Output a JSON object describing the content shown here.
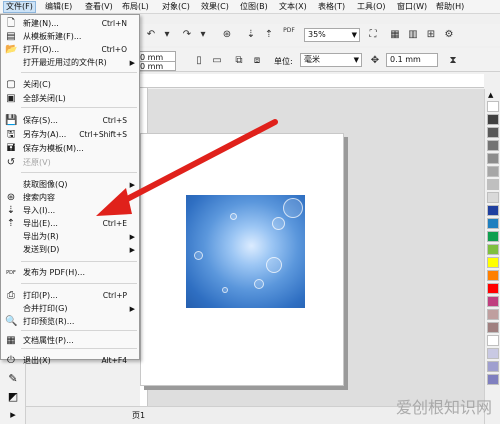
{
  "menubar": {
    "items": [
      {
        "label": "文件(F)",
        "active": true
      },
      {
        "label": "编辑(E)"
      },
      {
        "label": "查看(V)"
      },
      {
        "label": "布局(L)"
      },
      {
        "label": "对象(C)"
      },
      {
        "label": "效果(C)"
      },
      {
        "label": "位图(B)"
      },
      {
        "label": "文本(X)"
      },
      {
        "label": "表格(T)"
      },
      {
        "label": "工具(O)"
      },
      {
        "label": "窗口(W)"
      },
      {
        "label": "帮助(H)"
      }
    ]
  },
  "toolbar": {
    "zoom_value": "35%",
    "width_value": "0 mm",
    "height_value": "0 mm",
    "unit_label": "单位:",
    "unit_value": "毫米",
    "nudge_value": "0.1 mm",
    "pdf_label": "PDF"
  },
  "file_menu": {
    "items": [
      {
        "icon": "new-file-icon",
        "glyph": "🗋",
        "label": "新建(N)...",
        "shortcut": "Ctrl+N"
      },
      {
        "icon": "template-icon",
        "glyph": "▤",
        "label": "从模板新建(F)..."
      },
      {
        "icon": "open-folder-icon",
        "glyph": "📂",
        "label": "打开(O)...",
        "shortcut": "Ctrl+O"
      },
      {
        "icon": "",
        "glyph": "",
        "label": "打开最近用过的文件(R)",
        "submenu": true
      },
      {
        "icon": "close-icon",
        "glyph": "▢",
        "label": "关闭(C)"
      },
      {
        "icon": "close-all-icon",
        "glyph": "▣",
        "label": "全部关闭(L)"
      },
      {
        "icon": "save-icon",
        "glyph": "💾",
        "label": "保存(S)...",
        "shortcut": "Ctrl+S"
      },
      {
        "icon": "save-as-icon",
        "glyph": "🖫",
        "label": "另存为(A)...",
        "shortcut": "Ctrl+Shift+S"
      },
      {
        "icon": "save-template-icon",
        "glyph": "🖬",
        "label": "保存为模板(M)..."
      },
      {
        "icon": "revert-icon",
        "glyph": "↺",
        "label": "还原(V)",
        "disabled": true
      },
      {
        "icon": "",
        "glyph": "",
        "label": "获取图像(Q)",
        "submenu": true
      },
      {
        "icon": "search-content-icon",
        "glyph": "⊛",
        "label": "搜索内容"
      },
      {
        "icon": "import-icon",
        "glyph": "⇣",
        "label": "导入(I)..."
      },
      {
        "icon": "export-icon",
        "glyph": "⇡",
        "label": "导出(E)...",
        "shortcut": "Ctrl+E"
      },
      {
        "icon": "",
        "glyph": "",
        "label": "导出为(R)",
        "submenu": true
      },
      {
        "icon": "",
        "glyph": "",
        "label": "发送到(D)",
        "submenu": true
      },
      {
        "icon": "pdf-icon",
        "glyph": "PDF",
        "label": "发布为 PDF(H)..."
      },
      {
        "icon": "print-icon",
        "glyph": "⎙",
        "label": "打印(P)...",
        "shortcut": "Ctrl+P"
      },
      {
        "icon": "",
        "glyph": "",
        "label": "合并打印(G)",
        "submenu": true
      },
      {
        "icon": "print-preview-icon",
        "glyph": "🔍",
        "label": "打印预览(R)..."
      },
      {
        "icon": "doc-properties-icon",
        "glyph": "▦",
        "label": "文档属性(P)..."
      },
      {
        "icon": "exit-icon",
        "glyph": "⏻",
        "label": "退出(X)",
        "shortcut": "Alt+F4"
      }
    ]
  },
  "status_bar": {
    "page_label": "页1"
  },
  "watermark": "爱创根知识网",
  "colors": {
    "palette": [
      "#ffffff",
      "#404040",
      "#595959",
      "#737373",
      "#8c8c8c",
      "#a6a6a6",
      "#bfbfbf",
      "#d9d9d9",
      "#1f3f9f",
      "#1f7fbf",
      "#0f9f4f",
      "#7fbf3f",
      "#ffff00",
      "#ff7f00",
      "#ff0000",
      "#bf3f7f",
      "#bf9f9f",
      "#9f7f7f",
      "#ffffff",
      "#c9c9e3",
      "#9f9fcf",
      "#7f7fbf"
    ],
    "arrow": "#e0211b",
    "menu_highlight": "#cde3f7"
  }
}
